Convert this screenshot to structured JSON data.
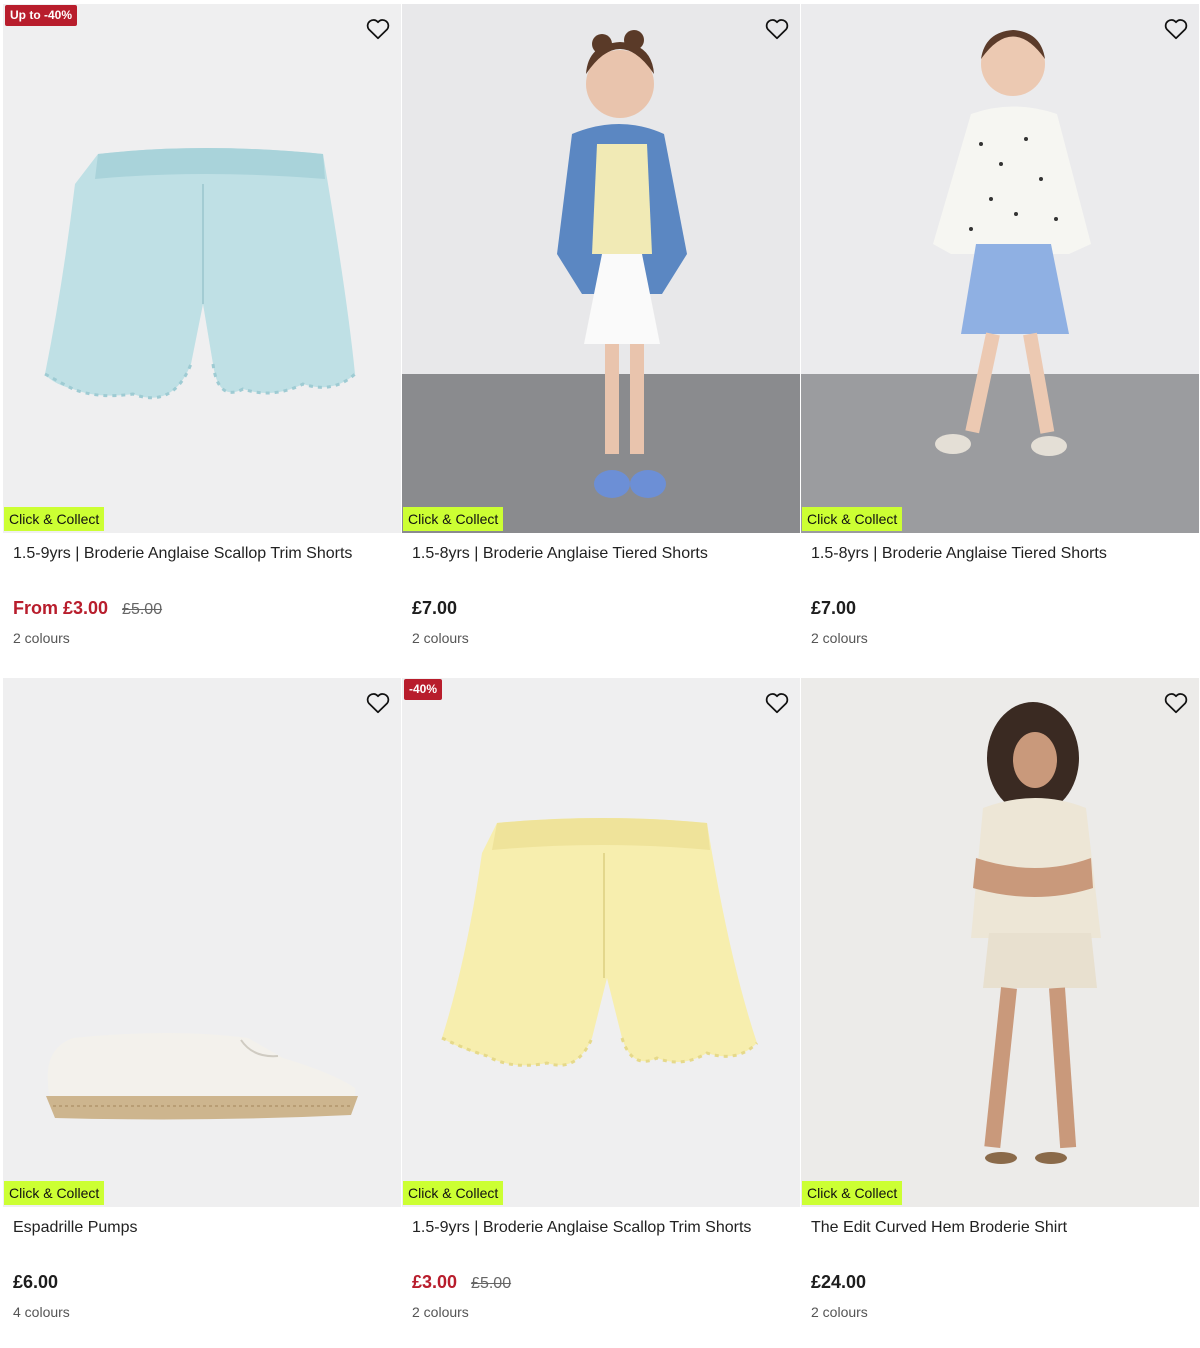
{
  "products": [
    {
      "promo": "Up to -40%",
      "image": "blue-shorts-image",
      "badge": "Click & Collect",
      "title": "1.5-9yrs | Broderie Anglaise Scallop Trim Shorts",
      "price": "From £3.00",
      "was": "£5.00",
      "colours": "2 colours",
      "price_color": "#b81d2c"
    },
    {
      "promo": "",
      "image": "girl-denim-jacket-image",
      "badge": "Click & Collect",
      "title": "1.5-8yrs | Broderie Anglaise Tiered Shorts",
      "price": "£7.00",
      "was": "",
      "colours": "2 colours"
    },
    {
      "promo": "",
      "image": "girl-polka-jacket-image",
      "badge": "Click & Collect",
      "title": "1.5-8yrs | Broderie Anglaise Tiered Shorts",
      "price": "£7.00",
      "was": "",
      "colours": "2 colours"
    },
    {
      "promo": "",
      "image": "espadrille-image",
      "badge": "Click & Collect",
      "title": "Espadrille Pumps",
      "price": "£6.00",
      "was": "",
      "colours": "4 colours"
    },
    {
      "promo": "-40%",
      "image": "yellow-shorts-image",
      "badge": "Click & Collect",
      "title": "1.5-9yrs | Broderie Anglaise Scallop Trim Shorts",
      "price": "£3.00",
      "was": "£5.00",
      "colours": "2 colours",
      "price_color": "#b81d2c"
    },
    {
      "promo": "",
      "image": "woman-broderie-shirt-image",
      "badge": "Click & Collect",
      "title": "The Edit Curved Hem Broderie Shirt",
      "price": "£24.00",
      "was": "",
      "colours": "2 colours"
    }
  ],
  "colors": {
    "promo_bg": "#b81d2c",
    "badge_bg": "#ccff33",
    "sale_price": "#b81d2c",
    "image_bg": "#efeff0"
  },
  "icons": {
    "favourite": "heart-outline-icon"
  }
}
